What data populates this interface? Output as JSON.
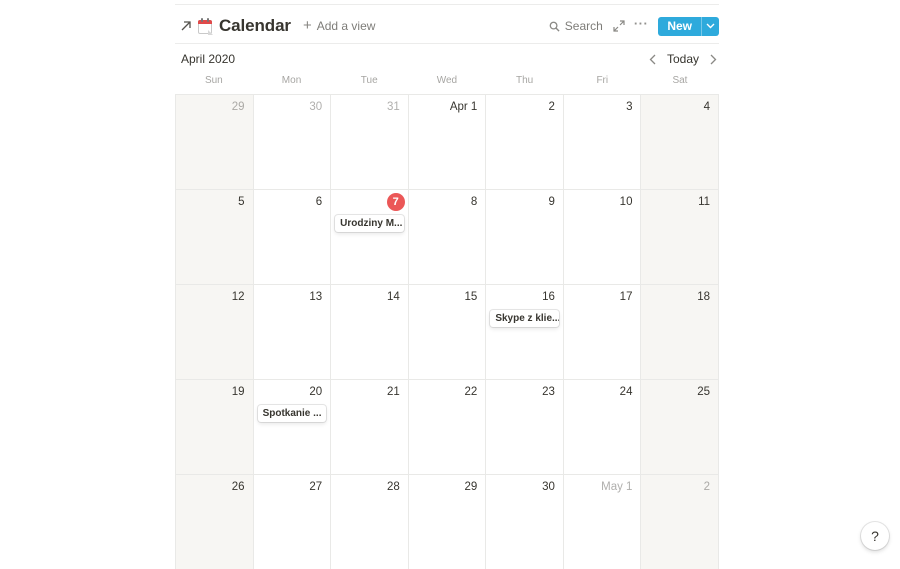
{
  "database": {
    "title": "Calendar",
    "icon": "calendar-emoji-icon",
    "add_view_label": "Add a view"
  },
  "toolbar": {
    "search_label": "Search",
    "new_label": "New"
  },
  "month_bar": {
    "title": "April 2020",
    "today_label": "Today"
  },
  "weekdays": [
    "Sun",
    "Mon",
    "Tue",
    "Wed",
    "Thu",
    "Fri",
    "Sat"
  ],
  "weeks": [
    [
      {
        "label": "29",
        "outside": true
      },
      {
        "label": "30",
        "outside": true
      },
      {
        "label": "31",
        "outside": true
      },
      {
        "label": "Apr 1"
      },
      {
        "label": "2"
      },
      {
        "label": "3"
      },
      {
        "label": "4"
      }
    ],
    [
      {
        "label": "5"
      },
      {
        "label": "6"
      },
      {
        "label": "7",
        "today": true,
        "event": "Urodziny M..."
      },
      {
        "label": "8"
      },
      {
        "label": "9"
      },
      {
        "label": "10"
      },
      {
        "label": "11"
      }
    ],
    [
      {
        "label": "12"
      },
      {
        "label": "13"
      },
      {
        "label": "14"
      },
      {
        "label": "15"
      },
      {
        "label": "16",
        "event": "Skype z klie..."
      },
      {
        "label": "17"
      },
      {
        "label": "18"
      }
    ],
    [
      {
        "label": "19"
      },
      {
        "label": "20",
        "event": "Spotkanie ..."
      },
      {
        "label": "21"
      },
      {
        "label": "22"
      },
      {
        "label": "23"
      },
      {
        "label": "24"
      },
      {
        "label": "25"
      }
    ],
    [
      {
        "label": "26"
      },
      {
        "label": "27"
      },
      {
        "label": "28"
      },
      {
        "label": "29"
      },
      {
        "label": "30"
      },
      {
        "label": "May 1",
        "outside": true
      },
      {
        "label": "2",
        "outside": true
      }
    ]
  ],
  "help_label": "?",
  "colors": {
    "accent": "#2eaadc",
    "today": "#eb5757",
    "weekend_bg": "#f7f6f3"
  }
}
